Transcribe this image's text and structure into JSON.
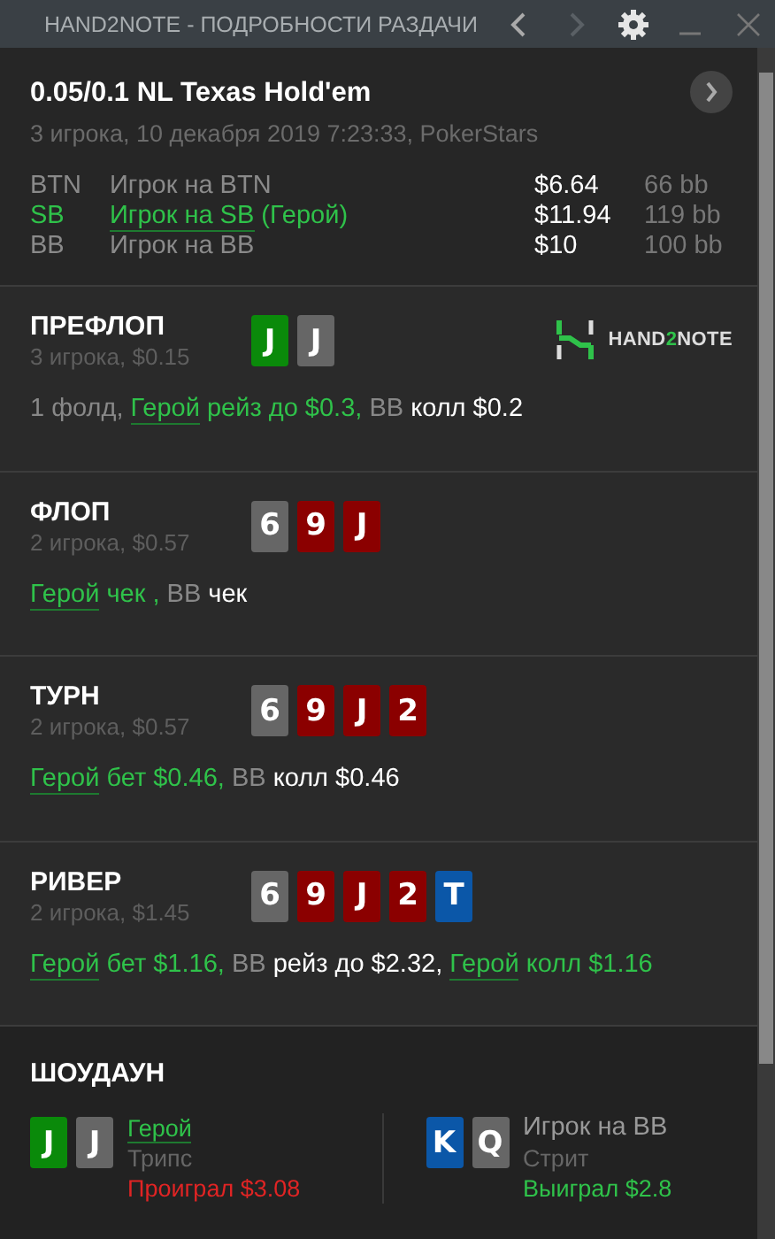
{
  "window": {
    "title": "HAND2NOTE - ПОДРОБНОСТИ РАЗДАЧИ"
  },
  "header": {
    "title": "0.05/0.1 NL Texas Hold'em",
    "subtitle": "3 игрока, 10 декабря 2019 7:23:33, PokerStars",
    "players": [
      {
        "position": "BTN",
        "name": "Игрок на BTN",
        "hero": false,
        "stack": "$6.64",
        "bb": "66 bb"
      },
      {
        "position": "SB",
        "name": "Игрок на SB",
        "note": "(Герой)",
        "hero": true,
        "stack": "$11.94",
        "bb": "119 bb"
      },
      {
        "position": "BB",
        "name": "Игрок на BB",
        "hero": false,
        "stack": "$10",
        "bb": "100 bb"
      }
    ]
  },
  "logo": {
    "text_left": "HAND",
    "text_mid": "2",
    "text_right": "NOTE"
  },
  "streets": [
    {
      "name": "ПРЕФЛОП",
      "info": "3 игрока, $0.15",
      "cards": [
        {
          "rank": "J",
          "color": "#0a8a0a"
        },
        {
          "rank": "J",
          "color": "#666666"
        }
      ],
      "actions": [
        {
          "kind": "muted",
          "text": "1 фолд,"
        },
        {
          "kind": "hero-link",
          "text": "Герой"
        },
        {
          "kind": "hero",
          "text": "рейз до $0.3,"
        },
        {
          "kind": "muted",
          "text": "BB"
        },
        {
          "kind": "plain",
          "text": "колл $0.2"
        }
      ]
    },
    {
      "name": "ФЛОП",
      "info": "2 игрока, $0.57",
      "cards": [
        {
          "rank": "6",
          "color": "#666666"
        },
        {
          "rank": "9",
          "color": "#8b0000"
        },
        {
          "rank": "J",
          "color": "#8b0000"
        }
      ],
      "actions": [
        {
          "kind": "hero-link",
          "text": "Герой"
        },
        {
          "kind": "hero",
          "text": "чек ,"
        },
        {
          "kind": "muted",
          "text": "BB"
        },
        {
          "kind": "plain",
          "text": "чек"
        }
      ]
    },
    {
      "name": "ТУРН",
      "info": "2 игрока, $0.57",
      "cards": [
        {
          "rank": "6",
          "color": "#666666"
        },
        {
          "rank": "9",
          "color": "#8b0000"
        },
        {
          "rank": "J",
          "color": "#8b0000"
        },
        {
          "rank": "2",
          "color": "#8b0000"
        }
      ],
      "actions": [
        {
          "kind": "hero-link",
          "text": "Герой"
        },
        {
          "kind": "hero",
          "text": "бет $0.46,"
        },
        {
          "kind": "muted",
          "text": "BB"
        },
        {
          "kind": "plain",
          "text": "колл $0.46"
        }
      ]
    },
    {
      "name": "РИВЕР",
      "info": "2 игрока, $1.45",
      "cards": [
        {
          "rank": "6",
          "color": "#666666"
        },
        {
          "rank": "9",
          "color": "#8b0000"
        },
        {
          "rank": "J",
          "color": "#8b0000"
        },
        {
          "rank": "2",
          "color": "#8b0000"
        },
        {
          "rank": "T",
          "color": "#0b57a8"
        }
      ],
      "actions": [
        {
          "kind": "hero-link",
          "text": "Герой"
        },
        {
          "kind": "hero",
          "text": "бет $1.16,"
        },
        {
          "kind": "muted",
          "text": "BB"
        },
        {
          "kind": "plain",
          "text": "рейз до $2.32,"
        },
        {
          "kind": "hero-link",
          "text": "Герой"
        },
        {
          "kind": "hero",
          "text": "колл $1.16"
        }
      ]
    }
  ],
  "showdown": {
    "title": "ШОУДАУН",
    "hands": [
      {
        "cards": [
          {
            "rank": "J",
            "color": "#0a8a0a"
          },
          {
            "rank": "J",
            "color": "#666666"
          }
        ],
        "player": "Герой",
        "hero": true,
        "combo": "Трипс",
        "result": "Проиграл $3.08",
        "won": false
      },
      {
        "cards": [
          {
            "rank": "K",
            "color": "#0b57a8"
          },
          {
            "rank": "Q",
            "color": "#666666"
          }
        ],
        "player": "Игрок на BB",
        "hero": false,
        "combo": "Стрит",
        "result": "Выиграл $2.8",
        "won": true
      }
    ]
  }
}
